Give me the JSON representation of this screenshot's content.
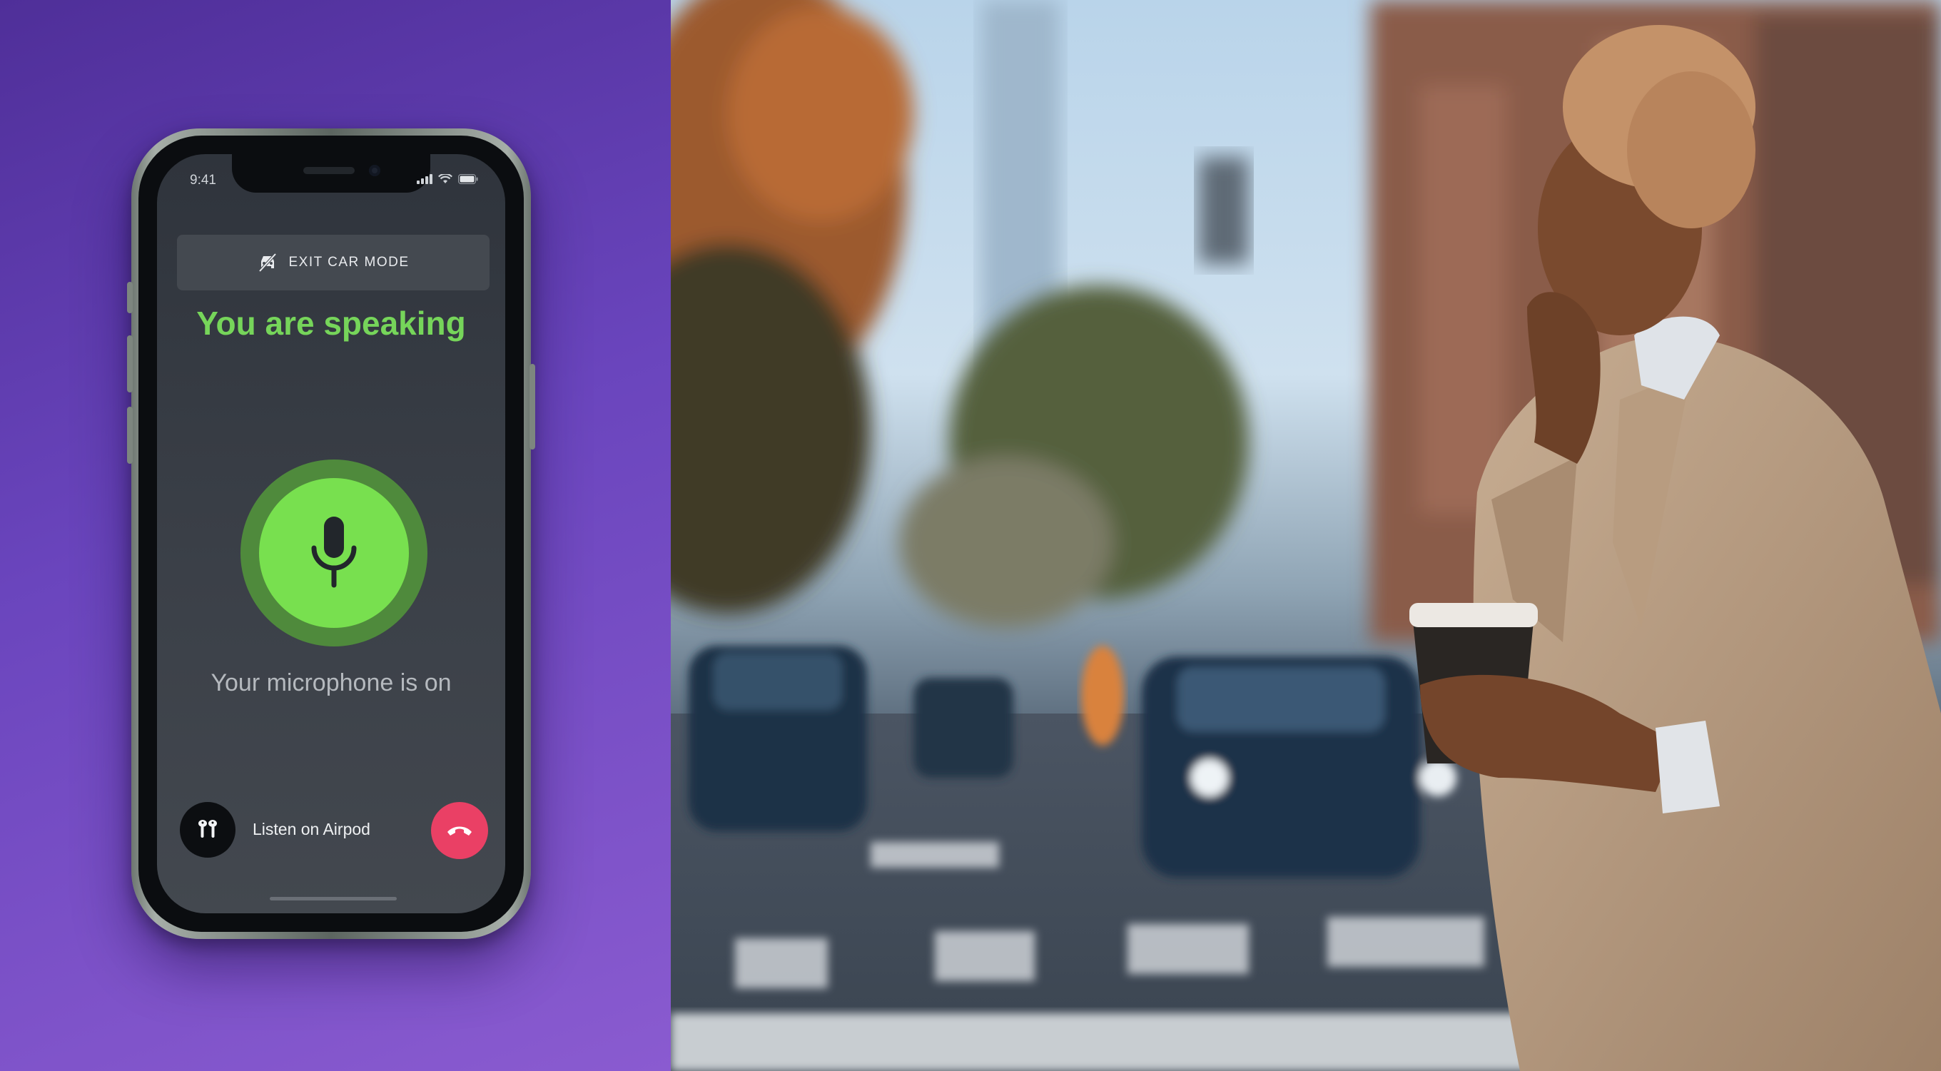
{
  "phone": {
    "status_time": "9:41",
    "exit_label": "EXIT CAR MODE",
    "title": "You are speaking",
    "subtitle": "Your microphone is on",
    "airpod_label": "Listen on Airpod",
    "accent_green": "#76d55a",
    "hangup_red": "#ea4065"
  },
  "icons": [
    "car-off-icon",
    "microphone-icon",
    "airpods-icon",
    "hang-up-icon",
    "signal-icon",
    "wifi-icon",
    "battery-icon"
  ],
  "photo": {
    "description_visible": false
  }
}
